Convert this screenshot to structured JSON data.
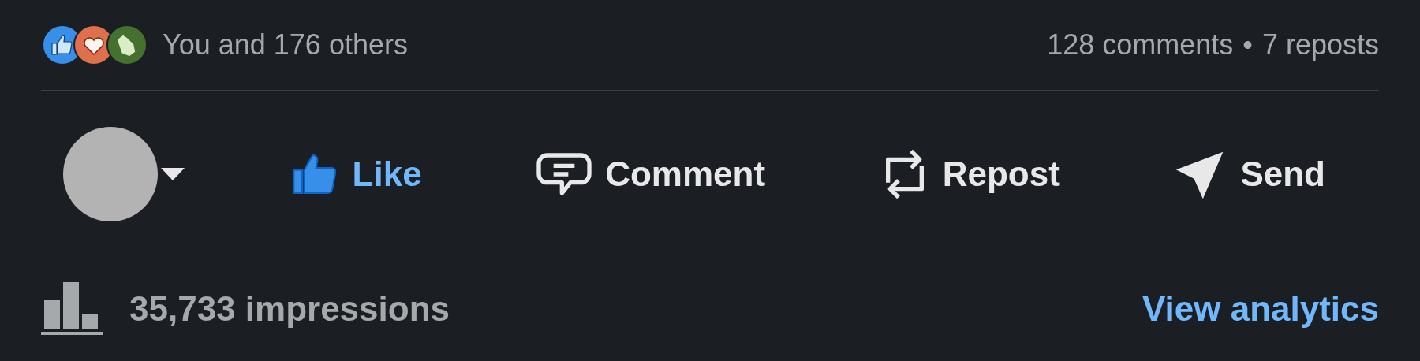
{
  "reactions": {
    "summary": "You and 176 others",
    "comments": "128 comments",
    "separator": "•",
    "reposts": "7 reposts"
  },
  "actions": [
    {
      "kind": "like",
      "label": "Like",
      "selected": true
    },
    {
      "kind": "comment",
      "label": "Comment",
      "selected": false
    },
    {
      "kind": "repost",
      "label": "Repost",
      "selected": false
    },
    {
      "kind": "send",
      "label": "Send",
      "selected": false
    }
  ],
  "footer": {
    "impressions": "35,733 impressions",
    "link": "View analytics"
  }
}
